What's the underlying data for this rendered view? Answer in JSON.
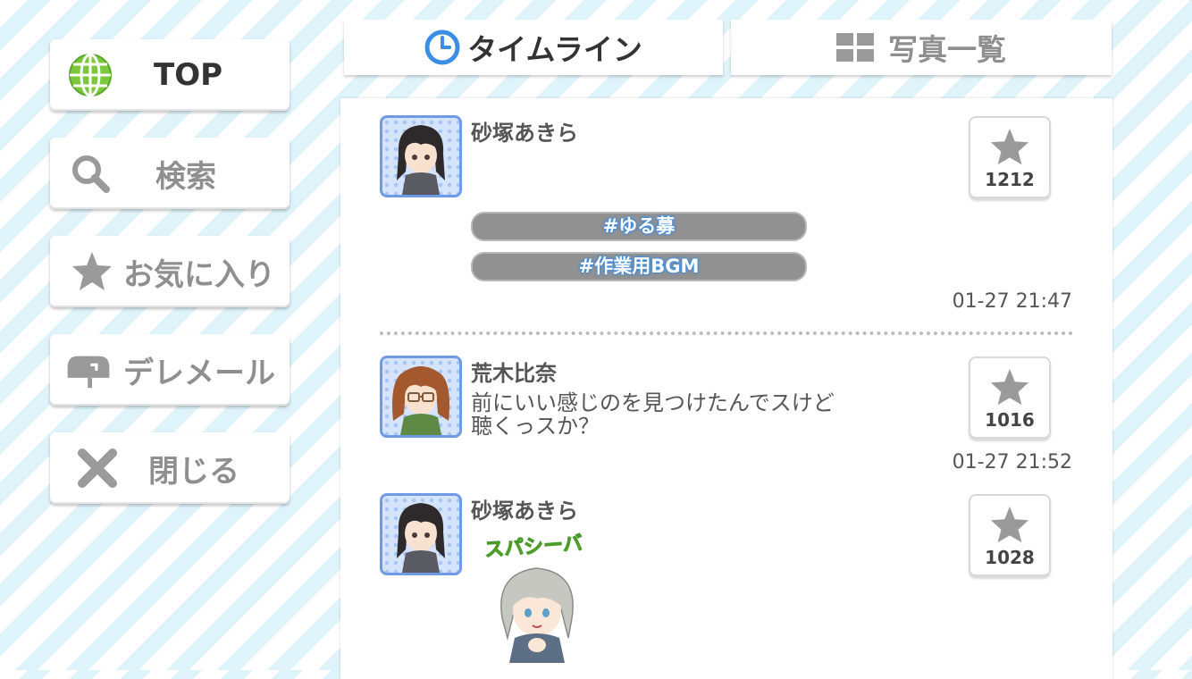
{
  "sidebar": {
    "items": [
      {
        "label": "TOP",
        "icon": "globe-icon"
      },
      {
        "label": "検索",
        "icon": "search-icon"
      },
      {
        "label": "お気に入り",
        "icon": "star-icon"
      },
      {
        "label": "デレメール",
        "icon": "mailbox-icon"
      },
      {
        "label": "閉じる",
        "icon": "close-icon"
      }
    ]
  },
  "tabs": [
    {
      "label": "タイムライン",
      "icon": "clock-icon",
      "active": true
    },
    {
      "label": "写真一覧",
      "icon": "grid-icon",
      "active": false
    }
  ],
  "posts": [
    {
      "user": "砂塚あきら",
      "text_lines": [],
      "tags": [
        "#ゆる募",
        "#作業用BGM"
      ],
      "likes": "1212",
      "time": "01-27 21:47"
    },
    {
      "user": "荒木比奈",
      "text_lines": [
        "前にいい感じのを見つけたんでスけど",
        "聴くっスか？"
      ],
      "tags": [],
      "likes": "1016",
      "time": "01-27 21:52"
    },
    {
      "user": "砂塚あきら",
      "text_lines": [],
      "tags": [],
      "likes": "1028",
      "stamp_text": "スパシーバ"
    }
  ],
  "colors": {
    "accent_blue": "#3a8ee8",
    "tag_gray": "#919191",
    "globe_green": "#7cc83a"
  }
}
